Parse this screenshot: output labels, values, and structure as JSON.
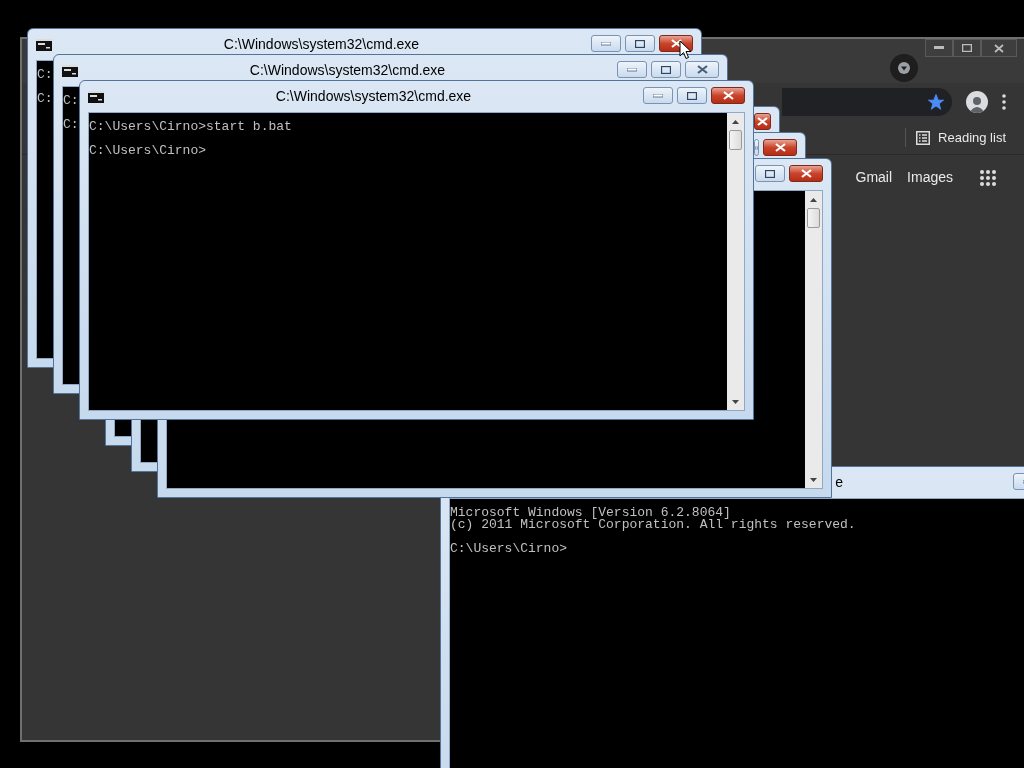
{
  "browser_window": {
    "bookmarked": true,
    "reading_list": "Reading list",
    "page_links": [
      "Gmail",
      "Images"
    ]
  },
  "console_windows": [
    {
      "title": "e",
      "blocks": [
        [
          "Microsoft Windows [Version 6.2.8064]",
          "(c) 2011 Microsoft Corporation. All rights reserved."
        ],
        [
          "C:\\Users\\Cirno>"
        ]
      ]
    },
    {
      "title": "C:\\Windows\\system32\\cmd.exe",
      "close_highlighted": true,
      "blocks": [
        [
          "C:"
        ],
        [
          "C:"
        ]
      ]
    },
    {
      "title": "C:\\Windows\\system32\\cmd.exe",
      "close_highlighted": false,
      "blocks": [
        [
          "C:"
        ],
        [
          "C:"
        ]
      ]
    },
    {
      "close_highlighted": true
    },
    {
      "close_highlighted": true
    },
    {
      "close_highlighted": true
    },
    {
      "title": "C:\\Windows\\system32\\cmd.exe",
      "close_highlighted": true,
      "blocks": [
        [
          "C:\\Users\\Cirno>start b.bat"
        ],
        [
          "C:\\Users\\Cirno>"
        ]
      ]
    }
  ]
}
